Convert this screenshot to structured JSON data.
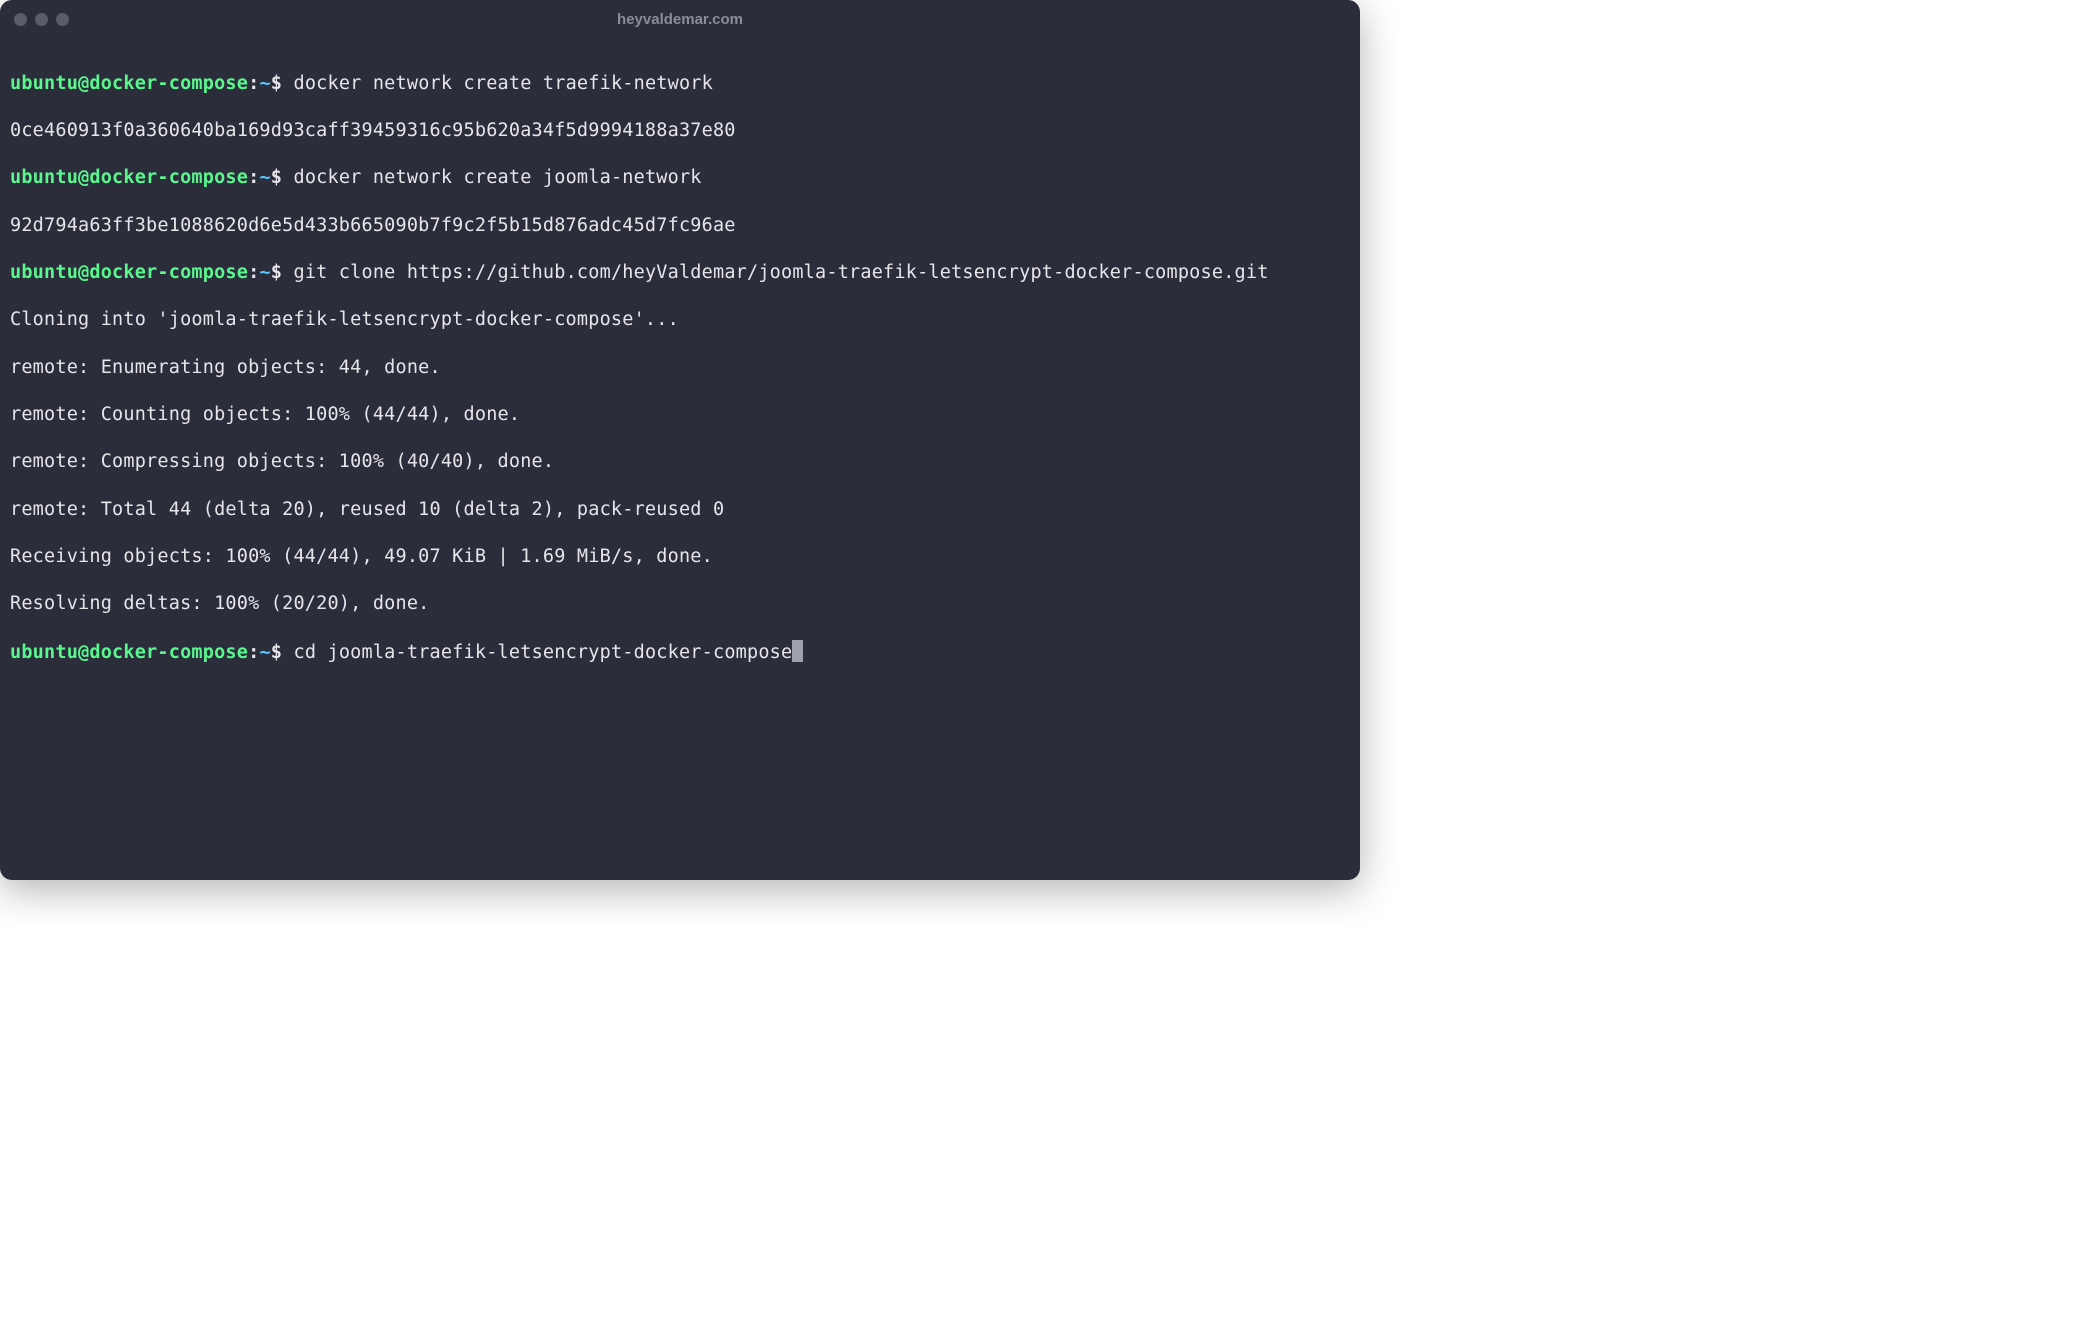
{
  "window": {
    "title": "heyvaldemar.com"
  },
  "prompt": {
    "user_host": "ubuntu@docker-compose",
    "colon": ":",
    "tilde": "~",
    "dollar": "$"
  },
  "lines": {
    "cmd1": " docker network create traefik-network",
    "out1": "0ce460913f0a360640ba169d93caff39459316c95b620a34f5d9994188a37e80",
    "cmd2": " docker network create joomla-network",
    "out2": "92d794a63ff3be1088620d6e5d433b665090b7f9c2f5b15d876adc45d7fc96ae",
    "cmd3": " git clone https://github.com/heyValdemar/joomla-traefik-letsencrypt-docker-compose.git",
    "out3": "Cloning into 'joomla-traefik-letsencrypt-docker-compose'...",
    "out4": "remote: Enumerating objects: 44, done.",
    "out5": "remote: Counting objects: 100% (44/44), done.",
    "out6": "remote: Compressing objects: 100% (40/40), done.",
    "out7": "remote: Total 44 (delta 20), reused 10 (delta 2), pack-reused 0",
    "out8": "Receiving objects: 100% (44/44), 49.07 KiB | 1.69 MiB/s, done.",
    "out9": "Resolving deltas: 100% (20/20), done.",
    "cmd4": " cd joomla-traefik-letsencrypt-docker-compose"
  }
}
